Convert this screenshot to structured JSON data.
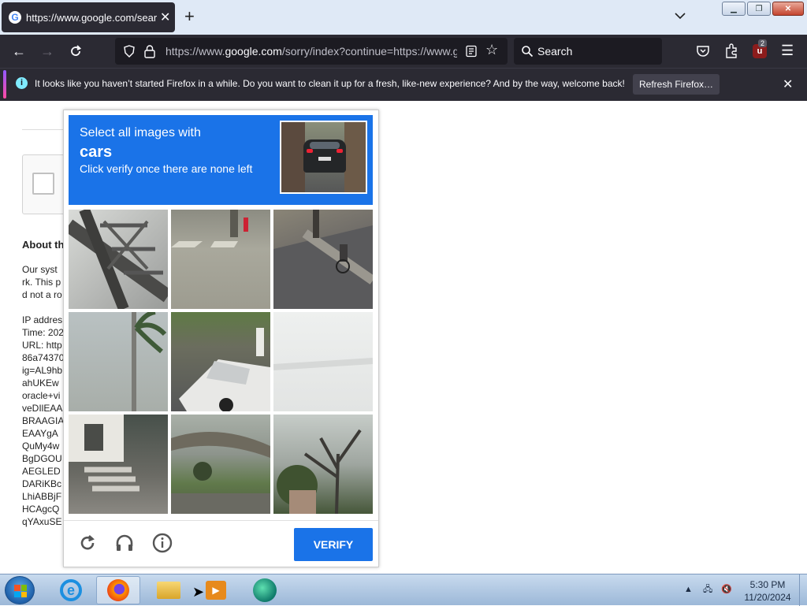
{
  "browser": {
    "tab_title": "https://www.google.com/search",
    "favicon_letter": "G",
    "new_tab_label": "+",
    "url_prefix": "https://www.",
    "url_domain": "google.com",
    "url_rest": "/sorry/index?continue=https://www.g",
    "search_placeholder": "Search",
    "extension_badge": "2"
  },
  "notification": {
    "message": "It looks like you haven’t started Firefox in a while. Do you want to clean it up for a fresh, like-new experience? And by the way, welcome back!",
    "button_label": "Refresh Firefox…",
    "info_glyph": "i"
  },
  "page": {
    "heading": "About th",
    "para_lines": [
      "Our syst",
      "rk. This p",
      "d not a ro"
    ],
    "details_lines": [
      "IP addres",
      "Time: 202",
      "URL: http",
      "86a74370",
      "ig=AL9hb",
      "ahUKEw",
      "oracle+vi",
      "veDIlEAA",
      "BRAAGIA",
      "EAAYgA",
      "QuMy4w",
      "BgDGOU",
      "AEGLED",
      "DARiKBc",
      "LhiABBjF",
      "HCAgcQ",
      "qYAxuSE"
    ]
  },
  "captcha": {
    "instruction_line1": "Select all images with",
    "target_object": "cars",
    "instruction_line3": "Click verify once there are none left",
    "verify_label": "VERIFY",
    "tiles": [
      {
        "name": "tile-bridge-truss"
      },
      {
        "name": "tile-crosswalk-hydrant"
      },
      {
        "name": "tile-street-cyclist"
      },
      {
        "name": "tile-palm-tree"
      },
      {
        "name": "tile-car-roadside"
      },
      {
        "name": "tile-faded-blank"
      },
      {
        "name": "tile-house-stairs"
      },
      {
        "name": "tile-overpass"
      },
      {
        "name": "tile-bare-tree-house"
      }
    ],
    "accent_color": "#1a73e8"
  },
  "taskbar": {
    "clock_time": "5:30 PM",
    "clock_date": "11/20/2024"
  }
}
